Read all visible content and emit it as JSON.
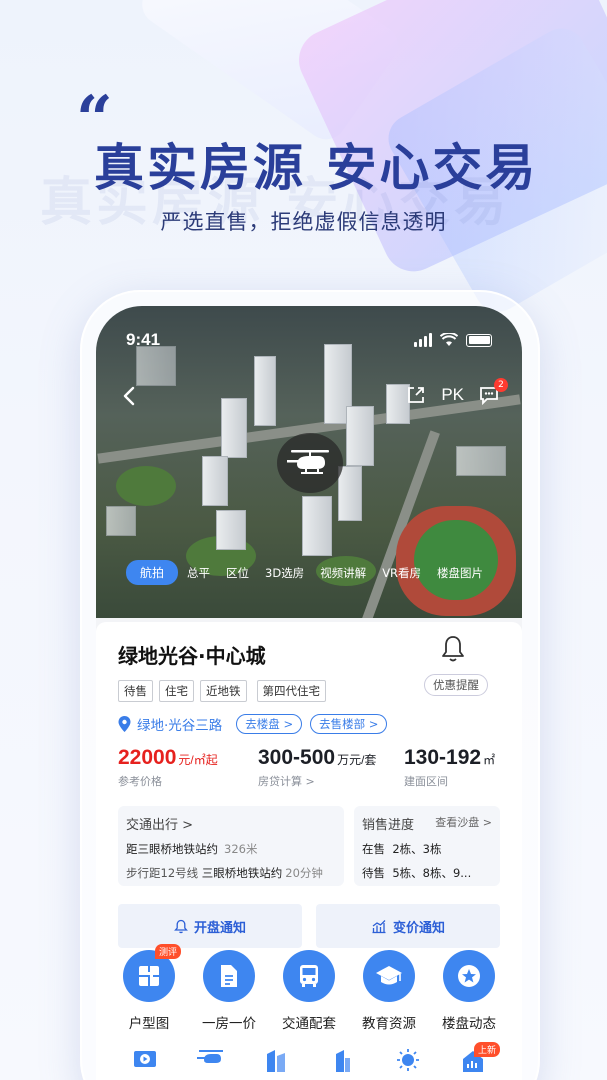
{
  "promo": {
    "headline": "真实房源  安心交易",
    "subhead": "严选直售，拒绝虚假信息透明"
  },
  "status_bar": {
    "time": "9:41"
  },
  "top_nav": {
    "pk_label": "PK",
    "message_badge": "2"
  },
  "media_tabs": [
    "航拍",
    "总平",
    "区位",
    "3D选房",
    "视频讲解",
    "VR看房",
    "楼盘图片"
  ],
  "property": {
    "name": "绿地光谷·中心城",
    "tags": [
      "待售",
      "住宅",
      "近地铁",
      "第四代住宅"
    ],
    "discount_alert": "优惠提醒",
    "location": "绿地·光谷三路",
    "go_to_building": "去楼盘 >",
    "go_to_sales_office": "去售楼部 >",
    "prices": [
      {
        "value": "22000",
        "unit": "元/㎡起",
        "label": "参考价格"
      },
      {
        "value": "300-500",
        "unit": "万元/套",
        "label": "房贷计算 >"
      },
      {
        "value": "130-192",
        "unit": "㎡",
        "label": "建面区间"
      }
    ]
  },
  "traffic": {
    "title": "交通出行 >",
    "line1_main": "距三眼桥地铁站约",
    "line1_dist": "326米",
    "line2_prefix": "步行距12号线",
    "line2_main": "三眼桥地铁站约",
    "line2_time": "20分钟"
  },
  "sales_progress": {
    "title": "销售进度",
    "more": "查看沙盘 >",
    "rows": [
      {
        "status": "在售",
        "buildings": "2栋、3栋"
      },
      {
        "status": "待售",
        "buildings": "5栋、8栋、9..."
      }
    ]
  },
  "notifications": {
    "opening": "开盘通知",
    "price_change": "变价通知"
  },
  "features": [
    {
      "label": "户型图",
      "icon": "floorplan-icon",
      "badge": "测评"
    },
    {
      "label": "一房一价",
      "icon": "document-icon",
      "badge": ""
    },
    {
      "label": "交通配套",
      "icon": "bus-icon",
      "badge": ""
    },
    {
      "label": "教育资源",
      "icon": "graduation-cap-icon",
      "badge": ""
    },
    {
      "label": "楼盘动态",
      "icon": "star-icon",
      "badge": ""
    }
  ],
  "bottom_icons": [
    {
      "icon": "video-icon",
      "badge": ""
    },
    {
      "icon": "helicopter-icon",
      "badge": ""
    },
    {
      "icon": "buildings-icon",
      "badge": ""
    },
    {
      "icon": "building-icon",
      "badge": ""
    },
    {
      "icon": "sun-icon",
      "badge": ""
    },
    {
      "icon": "house-chart-icon",
      "badge": "上新"
    }
  ],
  "colors": {
    "brand_blue": "#3e86f0",
    "headline_navy": "#2a3f9a",
    "price_red": "#e6211e"
  }
}
